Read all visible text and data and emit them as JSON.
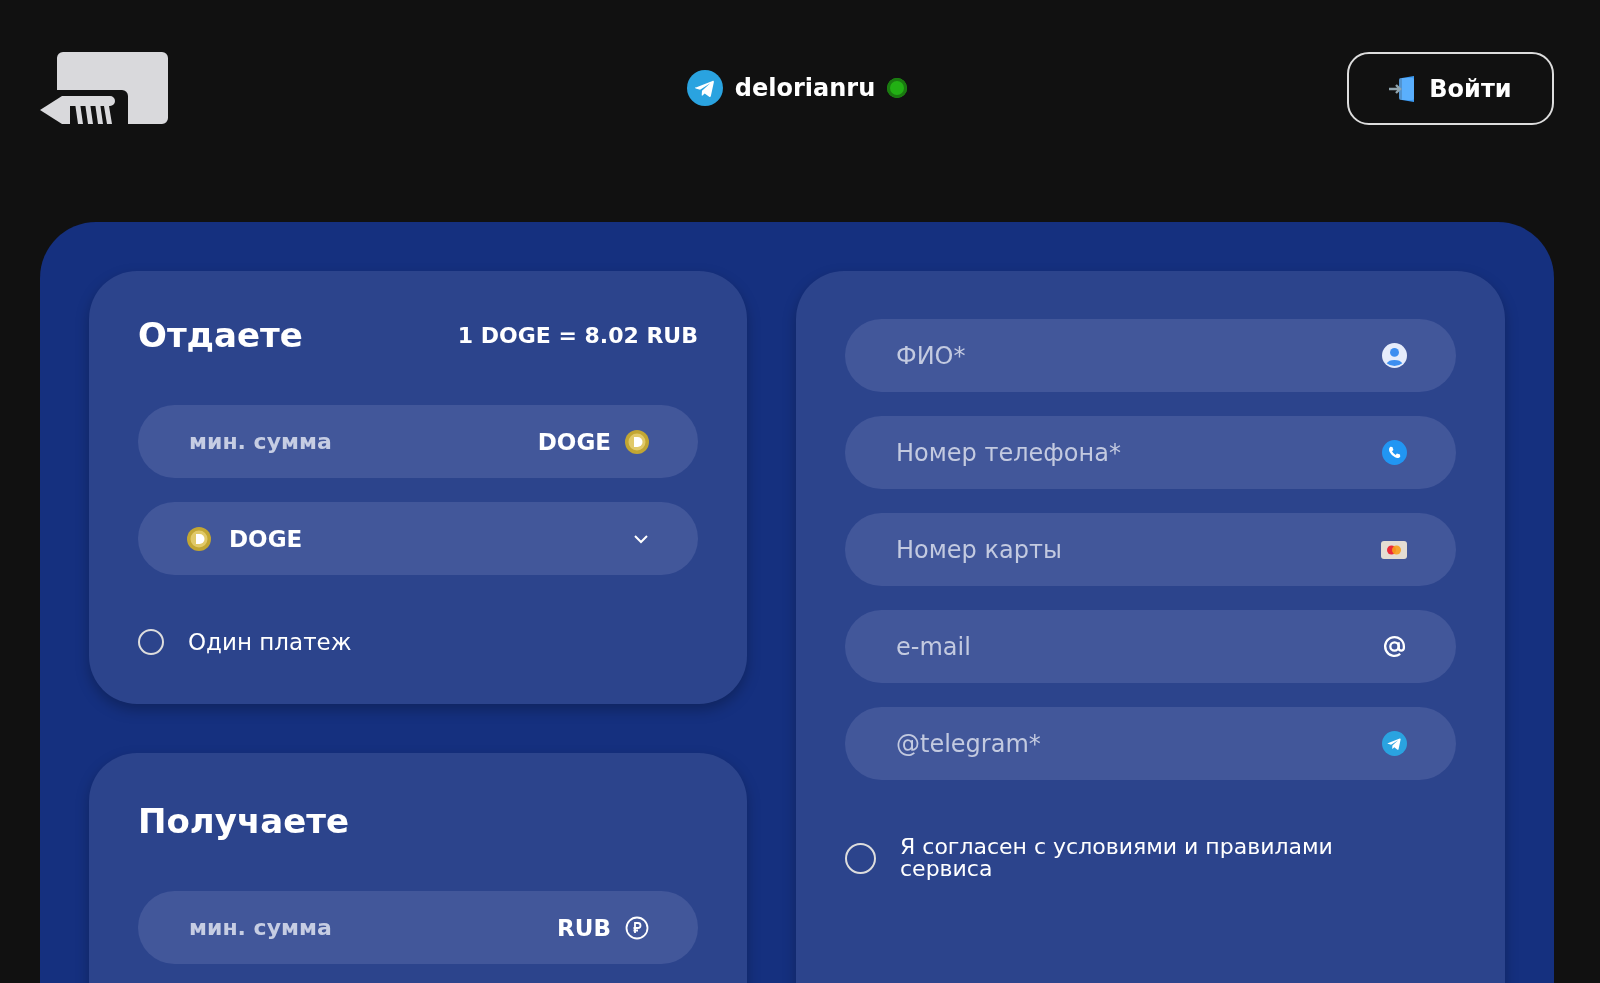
{
  "header": {
    "brand_name": "delorianru",
    "online": true,
    "login_button": "Войти"
  },
  "give": {
    "title": "Отдаете",
    "rate": "1 DOGE = 8.02 RUB",
    "amount": {
      "placeholder": "мин. сумма",
      "currency": "DOGE",
      "kind": "doge"
    },
    "select": {
      "value": "DOGE",
      "kind": "doge"
    },
    "single_payment": {
      "label": "Один платеж",
      "checked": false
    }
  },
  "receive": {
    "title": "Получаете",
    "amount": {
      "placeholder": "мин. сумма",
      "currency": "RUB",
      "kind": "rub"
    }
  },
  "contact_fields": [
    {
      "placeholder": "ФИО*",
      "kind": "person"
    },
    {
      "placeholder": "Номер телефона*",
      "kind": "phone"
    },
    {
      "placeholder": "Номер карты",
      "kind": "card"
    },
    {
      "placeholder": "e-mail",
      "kind": "email"
    },
    {
      "placeholder": "@telegram*",
      "kind": "telegram"
    }
  ],
  "agreement": {
    "label": "Я согласен с условиями и правилами сервиса",
    "checked": false
  }
}
